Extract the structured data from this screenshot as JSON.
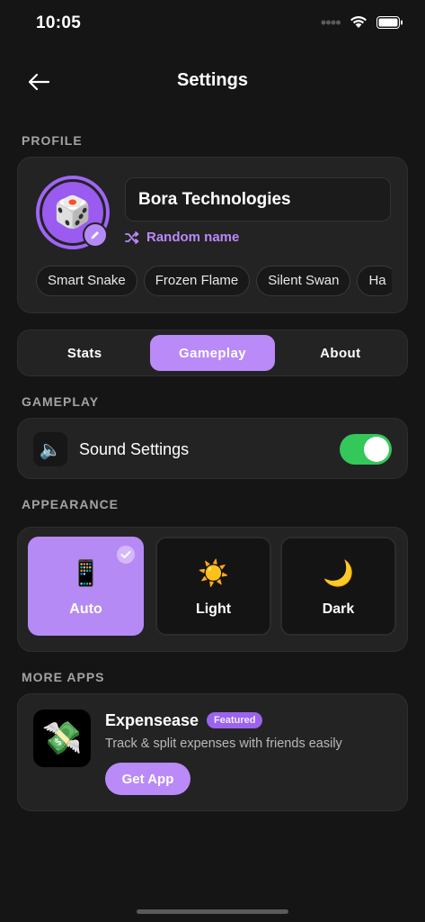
{
  "status_bar": {
    "time": "10:05"
  },
  "header": {
    "title": "Settings"
  },
  "sections": {
    "profile": "PROFILE",
    "gameplay": "GAMEPLAY",
    "appearance": "APPEARANCE",
    "more_apps": "MORE APPS"
  },
  "profile": {
    "avatar_emoji": "🎲",
    "name_value": "Bora Technologies",
    "random_name_label": "Random name",
    "suggestions": [
      "Smart Snake",
      "Frozen Flame",
      "Silent Swan",
      "Ha"
    ]
  },
  "tabs": [
    {
      "label": "Stats",
      "active": false
    },
    {
      "label": "Gameplay",
      "active": true
    },
    {
      "label": "About",
      "active": false
    }
  ],
  "gameplay": {
    "sound_label": "Sound Settings",
    "sound_icon": "🔈",
    "sound_enabled": true
  },
  "appearance": {
    "options": [
      {
        "label": "Auto",
        "emoji": "📱",
        "selected": true
      },
      {
        "label": "Light",
        "emoji": "☀️",
        "selected": false
      },
      {
        "label": "Dark",
        "emoji": "🌙",
        "selected": false
      }
    ]
  },
  "more_apps": {
    "app_name": "Expensease",
    "badge": "Featured",
    "description": "Track & split expenses with friends easily",
    "button_label": "Get App",
    "app_icon_emoji": "💸"
  },
  "colors": {
    "accent": "#b98af8",
    "background": "#151515",
    "card": "#232323",
    "toggle_on": "#34c759"
  }
}
